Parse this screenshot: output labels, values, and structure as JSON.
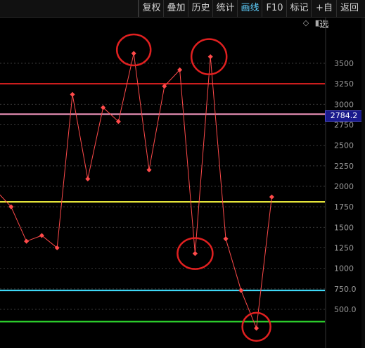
{
  "toolbar": {
    "buttons": [
      {
        "label": "复权",
        "active": false
      },
      {
        "label": "叠加",
        "active": false
      },
      {
        "label": "历史",
        "active": false
      },
      {
        "label": "统计",
        "active": false
      },
      {
        "label": "画线",
        "active": true
      },
      {
        "label": "F10",
        "active": false
      },
      {
        "label": "标记",
        "active": false
      },
      {
        "label": "+自选",
        "active": false
      },
      {
        "label": "返回",
        "active": false
      }
    ]
  },
  "tools": {
    "diamond_icon": "◇",
    "panel_icon": "◧"
  },
  "price_tag": "2784.2",
  "colors": {
    "line": "#ff4a4a",
    "red_level": "#e02020",
    "pink_level": "#ff9ec8",
    "yellow_level": "#ffff40",
    "cyan_level": "#40e0ff",
    "green_level": "#30e030",
    "circle": "#e02020"
  },
  "chart_data": {
    "type": "line",
    "y_ticks": [
      "3500",
      "3250",
      "3000",
      "2750",
      "2500",
      "2250",
      "2000",
      "1750",
      "1500",
      "1250",
      "1000",
      "750.0",
      "500.0"
    ],
    "ylim": [
      250,
      3750
    ],
    "series": [
      {
        "values": [
          1950,
          1750,
          1330,
          1400,
          1250,
          3120,
          2090,
          2960,
          2790,
          3620,
          2200,
          3220,
          3420,
          1180,
          3580,
          1360,
          730,
          270,
          1870
        ]
      }
    ],
    "levels": [
      {
        "value": 3250,
        "color": "red"
      },
      {
        "value": 2880,
        "color": "pink"
      },
      {
        "value": 1810,
        "color": "yellow"
      },
      {
        "value": 730,
        "color": "cyan"
      },
      {
        "value": 350,
        "color": "green"
      }
    ],
    "circled_points": [
      9,
      14,
      13,
      17
    ],
    "grid": true
  }
}
